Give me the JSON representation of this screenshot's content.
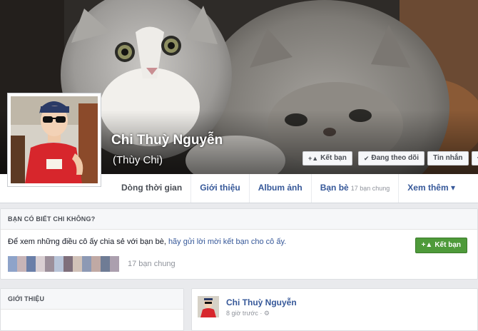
{
  "profile": {
    "name": "Chi Thuỳ Nguyễn",
    "alternate_name": "(Thùy Chi)"
  },
  "cover_actions": {
    "add_friend": "Kết bạn",
    "following": "Đang theo dõi",
    "message": "Tin nhắn",
    "more": "···"
  },
  "nav": {
    "tabs": [
      {
        "label": "Dòng thời gian"
      },
      {
        "label": "Giới thiệu"
      },
      {
        "label": "Album ảnh"
      },
      {
        "label": "Bạn bè",
        "sub": "17 bạn chung"
      },
      {
        "label": "Xem thêm ▾"
      }
    ]
  },
  "pymk": {
    "heading": "BẠN CÓ BIẾT CHI KHÔNG?",
    "message_prefix": "Để xem những điều cô ấy chia sẻ với bạn bè, ",
    "message_link": "hãy gửi lời mời kết bạn cho cô ấy.",
    "add_friend": "Kết bạn",
    "mutual_friends": "17 bạn chung"
  },
  "intro": {
    "heading": "GIỚI THIỆU"
  },
  "post": {
    "author": "Chi Thuỳ Nguyễn",
    "time": "8 giờ trước · ⚙"
  },
  "icons": {
    "add_friend": "person-plus-icon",
    "check": "check-icon",
    "globe": "globe-icon"
  },
  "colors": {
    "link": "#365899",
    "add_button": "#4e9a3a",
    "page_bg": "#e9eaed"
  }
}
